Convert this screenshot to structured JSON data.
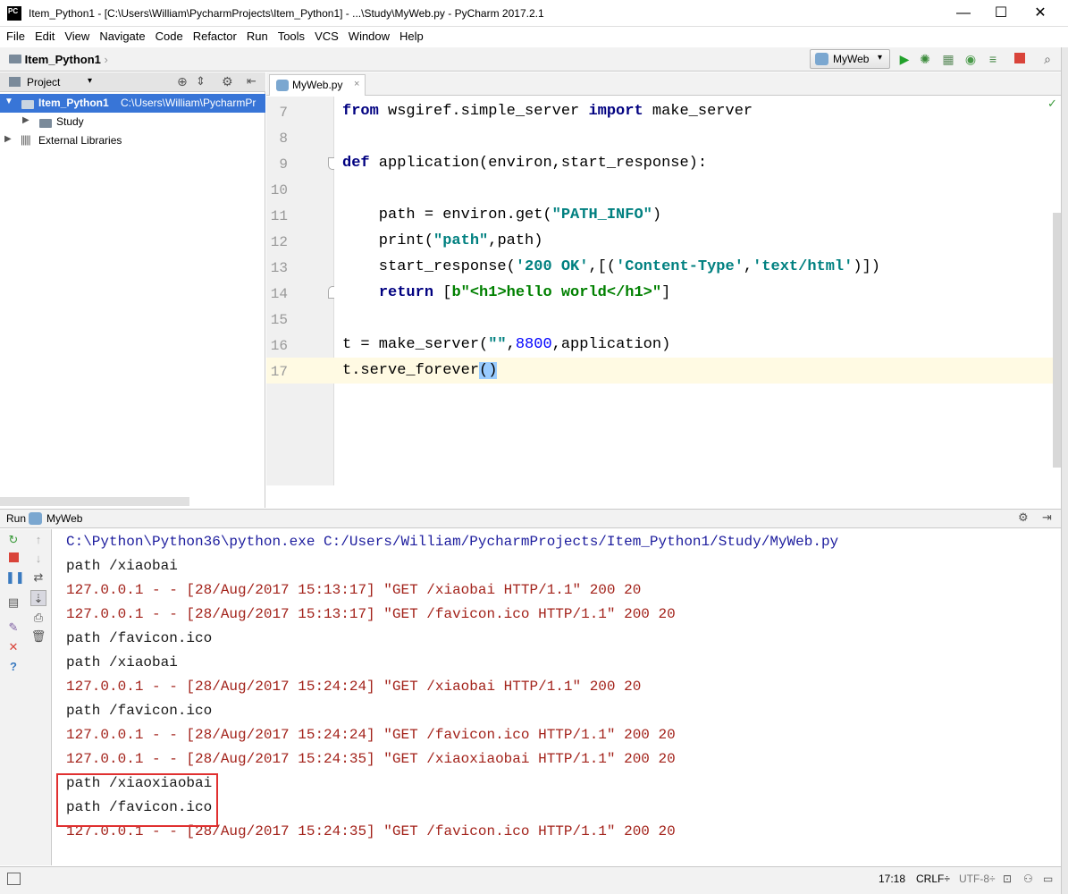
{
  "window": {
    "title": "Item_Python1 - [C:\\Users\\William\\PycharmProjects\\Item_Python1] - ...\\Study\\MyWeb.py - PyCharm 2017.2.1",
    "logo_text": "PC",
    "minimize": "—",
    "maximize": "☐",
    "close": "✕"
  },
  "menu": [
    "File",
    "Edit",
    "View",
    "Navigate",
    "Code",
    "Refactor",
    "Run",
    "Tools",
    "VCS",
    "Window",
    "Help"
  ],
  "navbar": {
    "breadcrumb": "Item_Python1",
    "run_config": "MyWeb"
  },
  "project": {
    "header": "Project",
    "root_name": "Item_Python1",
    "root_path": "C:\\Users\\William\\PycharmPr",
    "items": [
      "Study",
      "External Libraries"
    ]
  },
  "editor": {
    "tab": "MyWeb.py",
    "line_numbers": [
      "7",
      "8",
      "9",
      "10",
      "11",
      "12",
      "13",
      "14",
      "15",
      "16",
      "17"
    ],
    "code": {
      "l7": [
        "from",
        " wsgiref.simple_server ",
        "import",
        " make_server"
      ],
      "l9": [
        "def",
        " application(environ,start_response):"
      ],
      "l11": [
        "    path = environ.get(",
        "\"PATH_INFO\"",
        ")"
      ],
      "l12": [
        "    print(",
        "\"path\"",
        ",path)"
      ],
      "l13": [
        "    start_response(",
        "'200 OK'",
        ",[(",
        "'Content-Type'",
        ",",
        "'text/html'",
        ")])"
      ],
      "l14": [
        "    ",
        "return",
        " [",
        "b\"<h1>hello world</h1>\"",
        "]"
      ],
      "l16": [
        "t = make_server(",
        "\"\"",
        ",",
        "8800",
        ",application)"
      ],
      "l17": [
        "t.serve_forever",
        "()"
      ]
    }
  },
  "run": {
    "label": "Run",
    "config": "MyWeb",
    "console": [
      {
        "text": "C:\\Python\\Python36\\python.exe C:/Users/William/PycharmProjects/Item_Python1/Study/MyWeb.py",
        "kind": "blue"
      },
      {
        "text": "path /xiaobai",
        "kind": "black"
      },
      {
        "text": "127.0.0.1 - - [28/Aug/2017 15:13:17] \"GET /xiaobai HTTP/1.1\" 200 20",
        "kind": "red"
      },
      {
        "text": "127.0.0.1 - - [28/Aug/2017 15:13:17] \"GET /favicon.ico HTTP/1.1\" 200 20",
        "kind": "red"
      },
      {
        "text": "path /favicon.ico",
        "kind": "black"
      },
      {
        "text": "path /xiaobai",
        "kind": "black"
      },
      {
        "text": "127.0.0.1 - - [28/Aug/2017 15:24:24] \"GET /xiaobai HTTP/1.1\" 200 20",
        "kind": "red"
      },
      {
        "text": "path /favicon.ico",
        "kind": "black"
      },
      {
        "text": "127.0.0.1 - - [28/Aug/2017 15:24:24] \"GET /favicon.ico HTTP/1.1\" 200 20",
        "kind": "red"
      },
      {
        "text": "127.0.0.1 - - [28/Aug/2017 15:24:35] \"GET /xiaoxiaobai HTTP/1.1\" 200 20",
        "kind": "red"
      },
      {
        "text": "path /xiaoxiaobai",
        "kind": "black"
      },
      {
        "text": "path /favicon.ico",
        "kind": "black"
      },
      {
        "text": "127.0.0.1 - - [28/Aug/2017 15:24:35] \"GET /favicon.ico HTTP/1.1\" 200 20",
        "kind": "red"
      }
    ]
  },
  "status": {
    "position": "17:18",
    "line_sep": "CRLF÷",
    "encoding": "UTF-8÷"
  },
  "colors": {
    "selection": "#3875d7",
    "keyword": "#000080",
    "string": "#008080",
    "console_error": "#a3231b",
    "highlight_box": "#e03030"
  }
}
